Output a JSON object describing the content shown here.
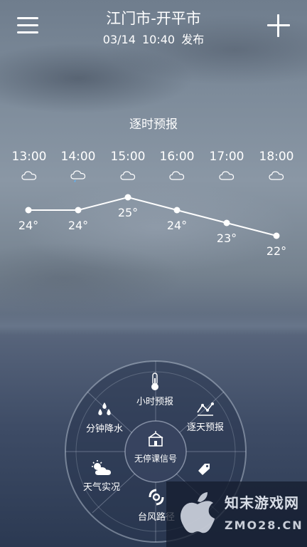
{
  "header": {
    "city": "江门市-开平市",
    "date": "03/14",
    "time": "10:40",
    "publish_suffix": "发布"
  },
  "forecast": {
    "title": "逐时预报",
    "hours": [
      {
        "time": "13:00",
        "icon": "cloud-icon",
        "temp": "24°",
        "value": 24
      },
      {
        "time": "14:00",
        "icon": "cloud-rain-icon",
        "temp": "24°",
        "value": 24
      },
      {
        "time": "15:00",
        "icon": "cloud-icon",
        "temp": "25°",
        "value": 25
      },
      {
        "time": "16:00",
        "icon": "cloud-icon",
        "temp": "24°",
        "value": 24
      },
      {
        "time": "17:00",
        "icon": "cloud-icon",
        "temp": "23°",
        "value": 23
      },
      {
        "time": "18:00",
        "icon": "cloud-icon",
        "temp": "22°",
        "value": 22
      }
    ]
  },
  "dial": {
    "center": "无停课信号",
    "items": {
      "hourly": "小时预报",
      "minute_rain": "分钟降水",
      "daily": "逐天预报",
      "live": "天气实况",
      "typhoon": "台风路径"
    }
  },
  "watermark": {
    "line1": "知末游戏网",
    "line2": "ZMO28.CN"
  }
}
